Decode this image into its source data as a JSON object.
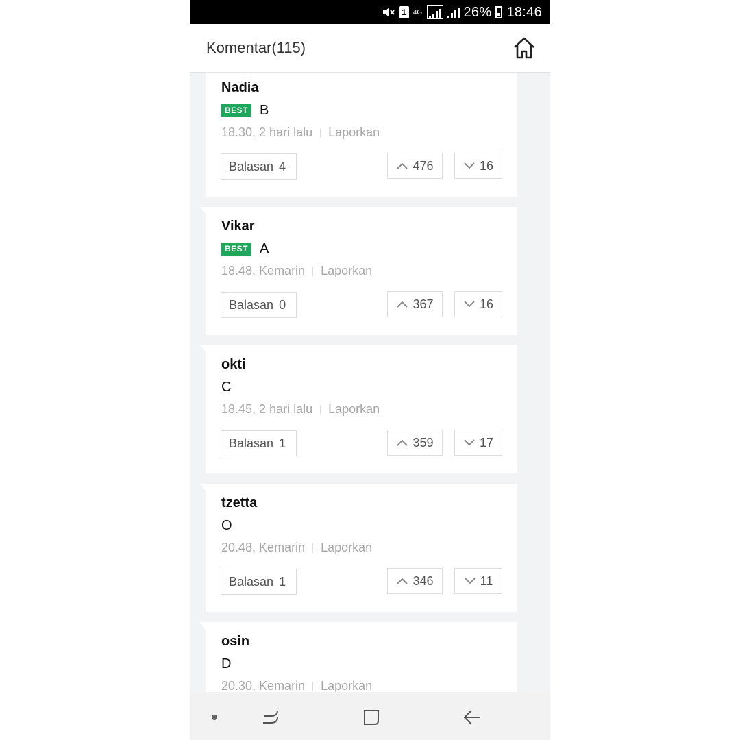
{
  "status_bar": {
    "network_label": "4G",
    "sim_slot": "1",
    "battery": "26%",
    "time": "18:46"
  },
  "header": {
    "title": "Komentar(115)"
  },
  "reply_label": "Balasan",
  "report_label": "Laporkan",
  "best_label": "BEST",
  "comments": [
    {
      "user": "Nadia",
      "text": "B",
      "best": true,
      "time": "18.30, 2 hari lalu",
      "replies": "4",
      "up": "476",
      "down": "16"
    },
    {
      "user": "Vikar",
      "text": "A",
      "best": true,
      "time": "18.48, Kemarin",
      "replies": "0",
      "up": "367",
      "down": "16"
    },
    {
      "user": "okti",
      "text": "C",
      "best": false,
      "time": "18.45, 2 hari lalu",
      "replies": "1",
      "up": "359",
      "down": "17"
    },
    {
      "user": "tzetta",
      "text": "O",
      "best": false,
      "time": "20.48, Kemarin",
      "replies": "1",
      "up": "346",
      "down": "11"
    },
    {
      "user": "osin",
      "text": "D",
      "best": false,
      "time": "20.30, Kemarin",
      "replies": "",
      "up": "",
      "down": ""
    }
  ],
  "colors": {
    "best_badge": "#1fa85c",
    "background": "#f2f3f5",
    "meta_text": "#a7a7a7"
  },
  "icons": {
    "home": "home-icon",
    "upvote": "chevron-up-icon",
    "downvote": "chevron-down-icon",
    "nav_recent": "recent-apps-icon",
    "nav_home": "home-square-icon",
    "nav_back": "back-arrow-icon"
  }
}
